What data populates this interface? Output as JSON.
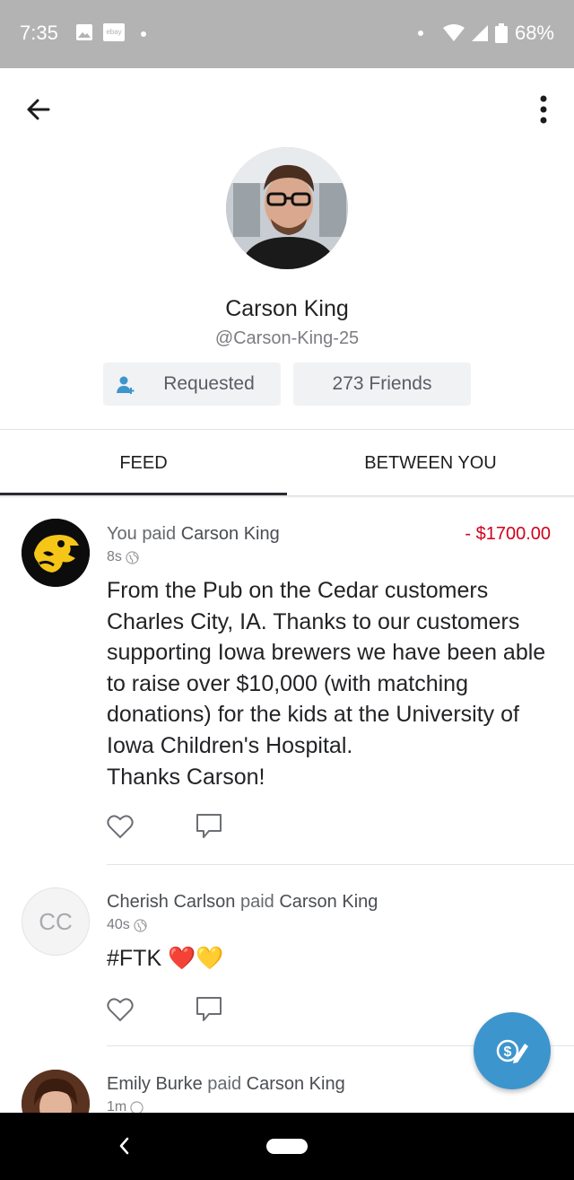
{
  "status_bar": {
    "time": "7:35",
    "notification_icons": [
      "image-icon",
      "ebay-icon"
    ],
    "ebay_label": "ebay",
    "battery": "68%"
  },
  "app_bar": {
    "back_icon": "arrow-left-icon",
    "more_icon": "more-vertical-icon"
  },
  "profile": {
    "name": "Carson King",
    "handle": "@Carson-King-25",
    "requested_label": "Requested",
    "friends_label": "273 Friends"
  },
  "tabs": [
    {
      "label": "FEED",
      "active": true
    },
    {
      "label": "BETWEEN YOU",
      "active": false
    }
  ],
  "feed": [
    {
      "actor": "You",
      "verb": "paid",
      "target": "Carson King",
      "amount": "- $1700.00",
      "time": "8s",
      "message": "From the Pub on the Cedar customers Charles City, IA. Thanks to our customers supporting Iowa brewers we have been able to raise over $10,000 (with matching donations) for the kids at the University of Iowa Children's Hospital.\nThanks Carson!"
    },
    {
      "actor": "Cherish Carlson",
      "initials": "CC",
      "verb": "paid",
      "target": "Carson King",
      "time": "40s",
      "message": "#FTK ❤️💛"
    },
    {
      "actor": "Emily Burke",
      "verb": "paid",
      "target": "Carson King",
      "time": "1m"
    }
  ],
  "colors": {
    "accent": "#3d95ce",
    "amount_negative": "#d0021b",
    "status_bar": "#b3b3b3"
  }
}
